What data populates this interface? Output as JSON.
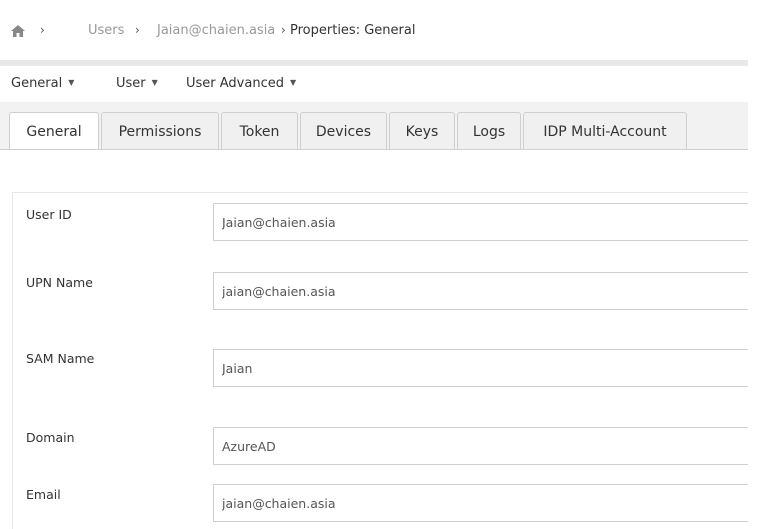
{
  "breadcrumb": {
    "home_icon": "home-icon",
    "separator": "›",
    "items": [
      "Users",
      "Jaian@chaien.asia",
      "Properties: General"
    ]
  },
  "menubar": {
    "items": [
      "General",
      "User",
      "User Advanced"
    ],
    "caret": "▼"
  },
  "tabs": [
    "General",
    "Permissions",
    "Token",
    "Devices",
    "Keys",
    "Logs",
    "IDP Multi-Account"
  ],
  "active_tab": "General",
  "form": {
    "fields": [
      {
        "label": "User ID",
        "value": "Jaian@chaien.asia"
      },
      {
        "label": "UPN Name",
        "value": "jaian@chaien.asia"
      },
      {
        "label": "SAM Name",
        "value": "Jaian"
      },
      {
        "label": "Domain",
        "value": "AzureAD"
      },
      {
        "label": "Email",
        "value": "jaian@chaien.asia"
      }
    ]
  },
  "colors": {
    "link_gray": "#999999",
    "tab_bg": "#f0f0f0",
    "border": "#cfcfcf"
  }
}
